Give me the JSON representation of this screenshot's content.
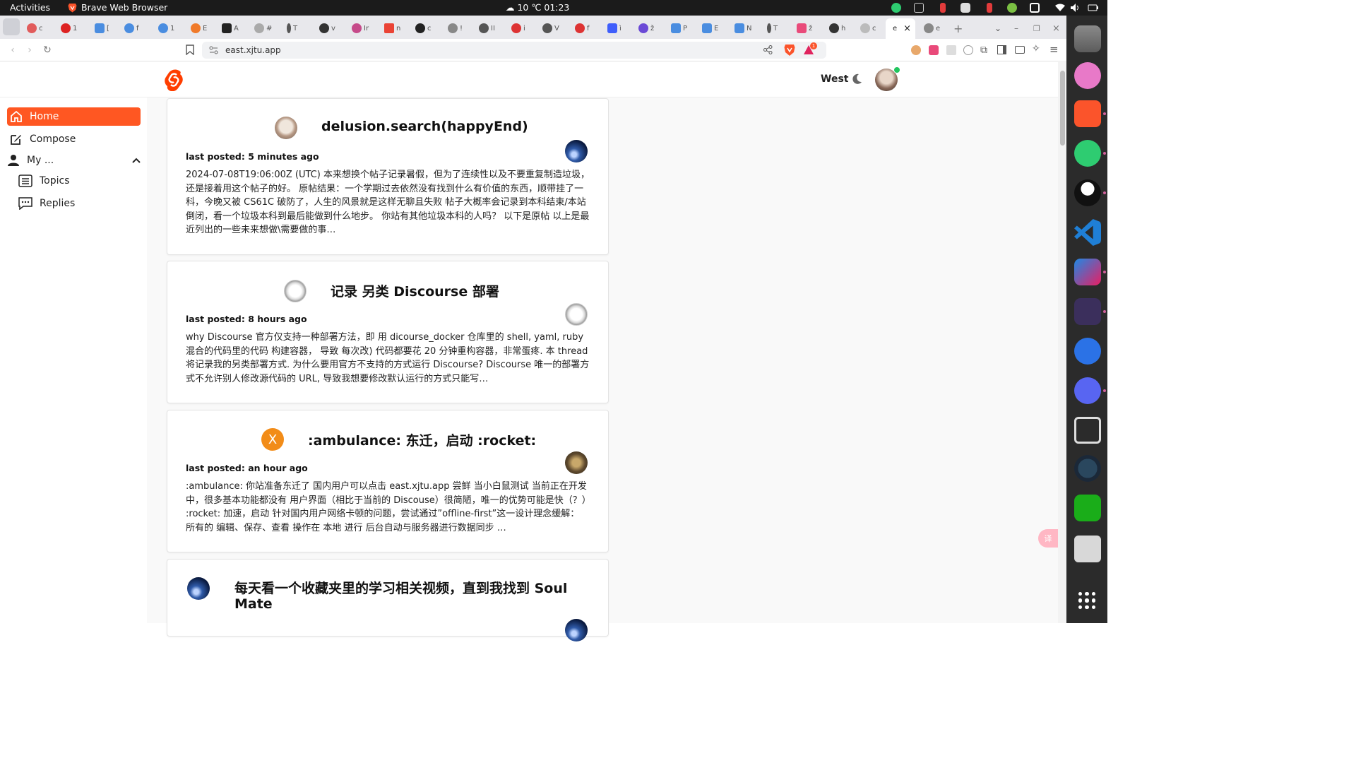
{
  "system": {
    "activities": "Activities",
    "app_name": "Brave Web Browser",
    "clock": "☁ 10 ℃  01:23"
  },
  "browser": {
    "url": "east.xjtu.app",
    "active_tab_label": "e",
    "shields_badge": "1"
  },
  "header": {
    "region": "West"
  },
  "sidebar": {
    "items": [
      {
        "label": "Home"
      },
      {
        "label": "Compose"
      },
      {
        "label": "My ..."
      },
      {
        "label": "Topics"
      },
      {
        "label": "Replies"
      }
    ]
  },
  "feed": {
    "topics": [
      {
        "title": "delusion.search(happyEnd)",
        "posted_label": "last posted: 5 minutes ago",
        "excerpt": "2024-07-08T19:06:00Z (UTC) 本来想换个帖子记录暑假，但为了连续性以及不要重复制造垃圾，还是接着用这个帖子的好。 原帖结果：一个学期过去依然没有找到什么有价值的东西，顺带挂了一科，今晚又被 CS61C 破防了，人生的风景就是这样无聊且失败 帖子大概率会记录到本科结束/本站倒闭，看一个垃圾本科到最后能做到什么地步。 你站有其他垃圾本科的人吗？ 以下是原帖 以上是最近列出的一些未来想做\\需要做的事…",
        "author_avatar": "anime-avatar",
        "last_poster_avatar": "space-avatar"
      },
      {
        "title": "记录 另类 Discourse 部署",
        "posted_label": "last posted: 8 hours ago",
        "excerpt": "why Discourse 官方仅支持一种部署方法，即 用 dicourse_docker 仓库里的 shell, yaml, ruby 混合的代码里的代码 构建容器， 导致 每次改) 代码都要花 20 分钟重构容器，非常蛋疼. 本 thread 将记录我的另类部署方式. 为什么要用官方不支持的方式运行 Discourse? Discourse 唯一的部署方式不允许别人修改源代码的 URL, 导致我想要修改默认运行的方式只能写…",
        "author_avatar": "sketch-avatar",
        "last_poster_avatar": "sketch-avatar"
      },
      {
        "title": ":ambulance: 东迁，启动 :rocket:",
        "posted_label": "last posted: an hour ago",
        "excerpt": ":ambulance: 你站准备东迁了 国内用户可以点击 east.xjtu.app 尝鲜 当小白鼠测试 当前正在开发中，很多基本功能都没有 用户界面（相比于当前的 Discouse）很简陋，唯一的优势可能是快（？） :rocket: 加速，启动 针对国内用户网络卡顿的问题，尝试通过”offline-first”这一设计理念缓解： 所有的 编辑、保存、查看 操作在 本地 进行 后台自动与服务器进行数据同步 …",
        "author_avatar_letter": "X",
        "last_poster_avatar": "autumn-avatar"
      },
      {
        "title_line1": "每天看一个收藏夹里的学习相关视频，直到我找到 Soul",
        "title_line2": "Mate",
        "author_avatar": "space-avatar"
      }
    ]
  },
  "colors": {
    "accent": "#ff5722",
    "online": "#22c55e",
    "x_avatar": "#f28c18",
    "dock_bg": "#2b2b2b",
    "topbar_bg": "#1b1b1b"
  }
}
